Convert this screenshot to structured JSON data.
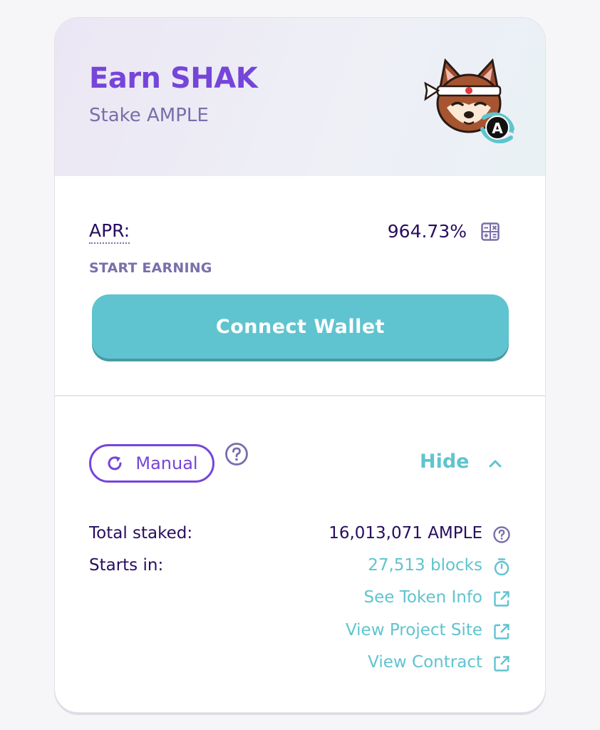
{
  "pool": {
    "title": "Earn SHAK",
    "subtitle": "Stake AMPLE",
    "token_badge_letter": "A"
  },
  "apr": {
    "label": "APR:",
    "value": "964.73%"
  },
  "start_earning": "START EARNING",
  "connect_button": "Connect Wallet",
  "manual_badge": "Manual",
  "details_toggle": "Hide",
  "details": {
    "total_staked_label": "Total staked:",
    "total_staked_value": "16,013,071 AMPLE",
    "starts_in_label": "Starts in:",
    "starts_in_value": "27,513 blocks"
  },
  "links": {
    "token_info": "See Token Info",
    "project_site": "View Project Site",
    "contract": "View Contract"
  },
  "colors": {
    "primary": "#7645d9",
    "accent": "#5fc4cf",
    "text": "#280d5f",
    "subtle": "#7a6eaa"
  }
}
